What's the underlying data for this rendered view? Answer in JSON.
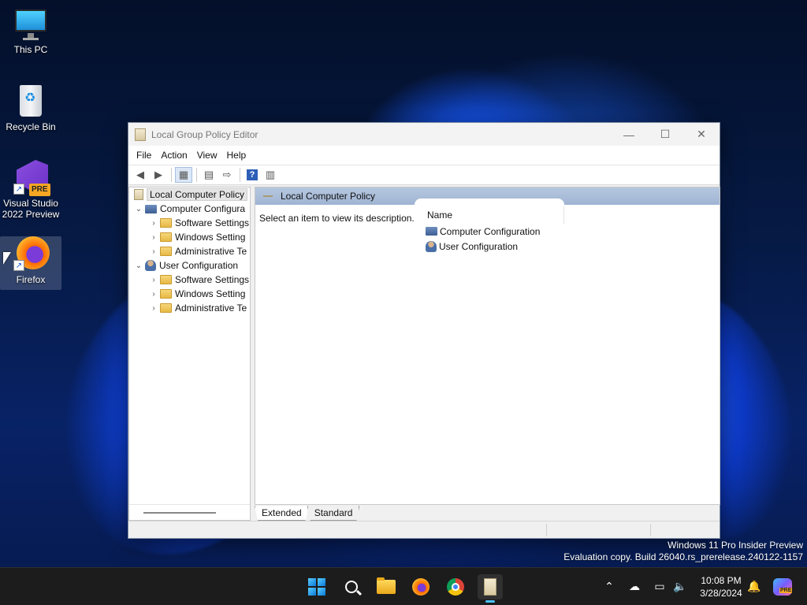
{
  "desktop": {
    "icons": [
      {
        "label": "This PC"
      },
      {
        "label": "Recycle Bin"
      },
      {
        "label": "Visual Studio 2022 Preview",
        "badge": "PRE"
      },
      {
        "label": "Firefox"
      }
    ],
    "watermark_line1": "Windows 11 Pro Insider Preview",
    "watermark_line2": "Evaluation copy. Build 26040.rs_prerelease.240122-1157"
  },
  "window": {
    "title": "Local Group Policy Editor",
    "controls": {
      "minimize": "—",
      "maximize": "☐",
      "close": "✕"
    },
    "menu": [
      "File",
      "Action",
      "View",
      "Help"
    ],
    "tree": {
      "root": "Local Computer Policy",
      "computer": {
        "label": "Computer Configura",
        "children": [
          "Software Settings",
          "Windows Setting",
          "Administrative Te"
        ]
      },
      "user": {
        "label": "User Configuration",
        "children": [
          "Software Settings",
          "Windows Setting",
          "Administrative Te"
        ]
      }
    },
    "right": {
      "header": "Local Computer Policy",
      "description": "Select an item to view its description.",
      "column_name": "Name",
      "items": [
        "Computer Configuration",
        "User Configuration"
      ]
    },
    "tabs": [
      "Extended",
      "Standard"
    ]
  },
  "taskbar": {
    "clock_time": "10:08 PM",
    "clock_date": "3/28/2024",
    "copilot_badge": "PRE",
    "accent": "#4cc2ff"
  },
  "icons": [
    "start-icon",
    "search-icon",
    "file-explorer-icon",
    "firefox-icon",
    "chrome-icon",
    "group-policy-icon",
    "chevron-up-icon",
    "onedrive-icon",
    "network-icon",
    "volume-icon",
    "notification-icon",
    "copilot-icon"
  ]
}
